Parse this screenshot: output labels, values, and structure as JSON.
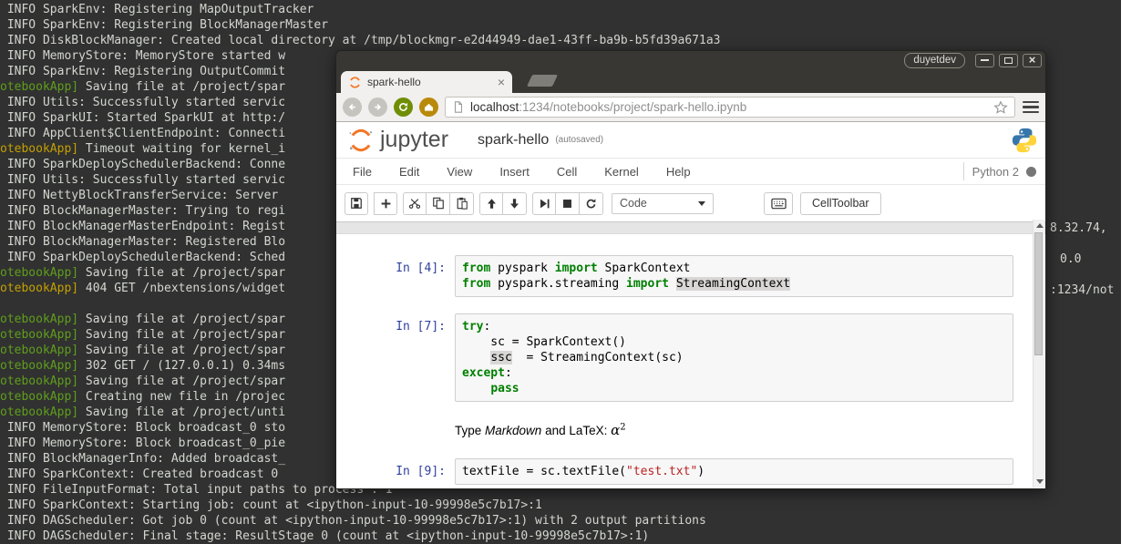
{
  "colors": {
    "jupyter_orange": "#F37626",
    "python_blue": "#3776AB",
    "python_yellow": "#FFD43B",
    "terminal_green": "#5f9e1c",
    "terminal_yellow": "#c4a000",
    "keyword_green": "#008000",
    "string_red": "#BA2121",
    "prompt_blue": "#303F9F"
  },
  "terminal": {
    "lines": [
      {
        "prefix": "",
        "prefix_color": "",
        "text": " INFO SparkEnv: Registering MapOutputTracker"
      },
      {
        "prefix": "",
        "prefix_color": "",
        "text": " INFO SparkEnv: Registering BlockManagerMaster"
      },
      {
        "prefix": "",
        "prefix_color": "",
        "text": " INFO DiskBlockManager: Created local directory at /tmp/blockmgr-e2d44949-dae1-43ff-ba9b-b5fd39a671a3"
      },
      {
        "prefix": "",
        "prefix_color": "",
        "text": " INFO MemoryStore: MemoryStore started w"
      },
      {
        "prefix": "",
        "prefix_color": "",
        "text": " INFO SparkEnv: Registering OutputCommit"
      },
      {
        "prefix": "otebookApp]",
        "prefix_color": "green",
        "text": " Saving file at /project/spar"
      },
      {
        "prefix": "",
        "prefix_color": "",
        "text": " INFO Utils: Successfully started servic"
      },
      {
        "prefix": "",
        "prefix_color": "",
        "text": " INFO SparkUI: Started SparkUI at http:/"
      },
      {
        "prefix": "",
        "prefix_color": "",
        "text": " INFO AppClient$ClientEndpoint: Connecti"
      },
      {
        "prefix": "otebookApp]",
        "prefix_color": "yellow",
        "text": " Timeout waiting for kernel_i"
      },
      {
        "prefix": "",
        "prefix_color": "",
        "text": " INFO SparkDeploySchedulerBackend: Conne"
      },
      {
        "prefix": "",
        "prefix_color": "",
        "text": " INFO Utils: Successfully started servic"
      },
      {
        "prefix": "",
        "prefix_color": "",
        "text": " INFO NettyBlockTransferService: Server"
      },
      {
        "prefix": "",
        "prefix_color": "",
        "text": " INFO BlockManagerMaster: Trying to regi"
      },
      {
        "prefix": "",
        "prefix_color": "",
        "text": " INFO BlockManagerMasterEndpoint: Regist"
      },
      {
        "prefix": "",
        "prefix_color": "",
        "text": " INFO BlockManagerMaster: Registered Blo"
      },
      {
        "prefix": "",
        "prefix_color": "",
        "text": " INFO SparkDeploySchedulerBackend: Sched"
      },
      {
        "prefix": "otebookApp]",
        "prefix_color": "green",
        "text": " Saving file at /project/spar"
      },
      {
        "prefix": "otebookApp]",
        "prefix_color": "yellow",
        "text": " 404 GET /nbextensions/widget"
      },
      {
        "prefix": "",
        "prefix_color": "",
        "text": ""
      },
      {
        "prefix": "otebookApp]",
        "prefix_color": "green",
        "text": " Saving file at /project/spar"
      },
      {
        "prefix": "otebookApp]",
        "prefix_color": "green",
        "text": " Saving file at /project/spar"
      },
      {
        "prefix": "otebookApp]",
        "prefix_color": "green",
        "text": " Saving file at /project/spar"
      },
      {
        "prefix": "otebookApp]",
        "prefix_color": "green",
        "text": " 302 GET / (127.0.0.1) 0.34ms"
      },
      {
        "prefix": "otebookApp]",
        "prefix_color": "green",
        "text": " Saving file at /project/spar"
      },
      {
        "prefix": "otebookApp]",
        "prefix_color": "green",
        "text": " Creating new file in /projec"
      },
      {
        "prefix": "otebookApp]",
        "prefix_color": "green",
        "text": " Saving file at /project/unti"
      },
      {
        "prefix": "",
        "prefix_color": "",
        "text": " INFO MemoryStore: Block broadcast_0 sto"
      },
      {
        "prefix": "",
        "prefix_color": "",
        "text": " INFO MemoryStore: Block broadcast_0_pie"
      },
      {
        "prefix": "",
        "prefix_color": "",
        "text": " INFO BlockManagerInfo: Added broadcast_"
      },
      {
        "prefix": "",
        "prefix_color": "",
        "text": " INFO SparkContext: Created broadcast 0"
      },
      {
        "prefix": "",
        "prefix_color": "",
        "text": " INFO FileInputFormat: Total input paths to process : 1"
      },
      {
        "prefix": "",
        "prefix_color": "",
        "text": " INFO SparkContext: Starting job: count at <ipython-input-10-99998e5c7b17>:1"
      },
      {
        "prefix": "",
        "prefix_color": "",
        "text": " INFO DAGScheduler: Got job 0 (count at <ipython-input-10-99998e5c7b17>:1) with 2 output partitions"
      },
      {
        "prefix": "",
        "prefix_color": "",
        "text": " INFO DAGScheduler: Final stage: ResultStage 0 (count at <ipython-input-10-99998e5c7b17>:1)"
      }
    ],
    "fragments": [
      {
        "text": "8.32.74,",
        "row": 15,
        "indent": 0
      },
      {
        "text": "0.0",
        "row": 17,
        "indent": 1
      },
      {
        "text": ":1234/not",
        "row": 19,
        "indent": 0
      }
    ]
  },
  "window": {
    "profile": "duyetdev",
    "tab_title": "spark-hello",
    "url_host": "localhost",
    "url_path": ":1234/notebooks/project/spark-hello.ipynb"
  },
  "notebook": {
    "title": "spark-hello",
    "autosaved": "(autosaved)",
    "menu": [
      "File",
      "Edit",
      "View",
      "Insert",
      "Cell",
      "Kernel",
      "Help"
    ],
    "kernel": "Python 2",
    "toolbar": {
      "cell_type": "Code",
      "celltoolbar": "CellToolbar"
    },
    "cells": [
      {
        "type": "code",
        "prompt": "In [4]:",
        "source": [
          [
            [
              "k",
              "from"
            ],
            [
              "t",
              " pyspark "
            ],
            [
              "k",
              "import"
            ],
            [
              "t",
              " SparkContext"
            ]
          ],
          [
            [
              "k",
              "from"
            ],
            [
              "t",
              " pyspark.streaming "
            ],
            [
              "k",
              "import"
            ],
            [
              "t",
              " "
            ],
            [
              "h",
              "StreamingContext"
            ]
          ]
        ]
      },
      {
        "type": "code",
        "prompt": "In [7]:",
        "source": [
          [
            [
              "k",
              "try"
            ],
            [
              "t",
              ":"
            ]
          ],
          [
            [
              "t",
              "    sc = SparkContext()"
            ]
          ],
          [
            [
              "t",
              "    "
            ],
            [
              "h",
              "ssc"
            ],
            [
              "t",
              "  = StreamingContext(sc)"
            ]
          ],
          [
            [
              "k",
              "except"
            ],
            [
              "t",
              ":"
            ]
          ],
          [
            [
              "t",
              "    "
            ],
            [
              "k",
              "pass"
            ]
          ]
        ]
      },
      {
        "type": "markdown",
        "prompt": "",
        "source": [
          [
            [
              "t",
              "Type "
            ],
            [
              "i",
              "Markdown"
            ],
            [
              "t",
              " and LaTeX: "
            ],
            [
              "m",
              "α"
            ],
            [
              "sup",
              "2"
            ]
          ]
        ]
      },
      {
        "type": "code",
        "prompt": "In [9]:",
        "source": [
          [
            [
              "t",
              "textFile = sc.textFile("
            ],
            [
              "s",
              "\"test.txt\""
            ],
            [
              "t",
              ")"
            ]
          ]
        ]
      }
    ]
  }
}
